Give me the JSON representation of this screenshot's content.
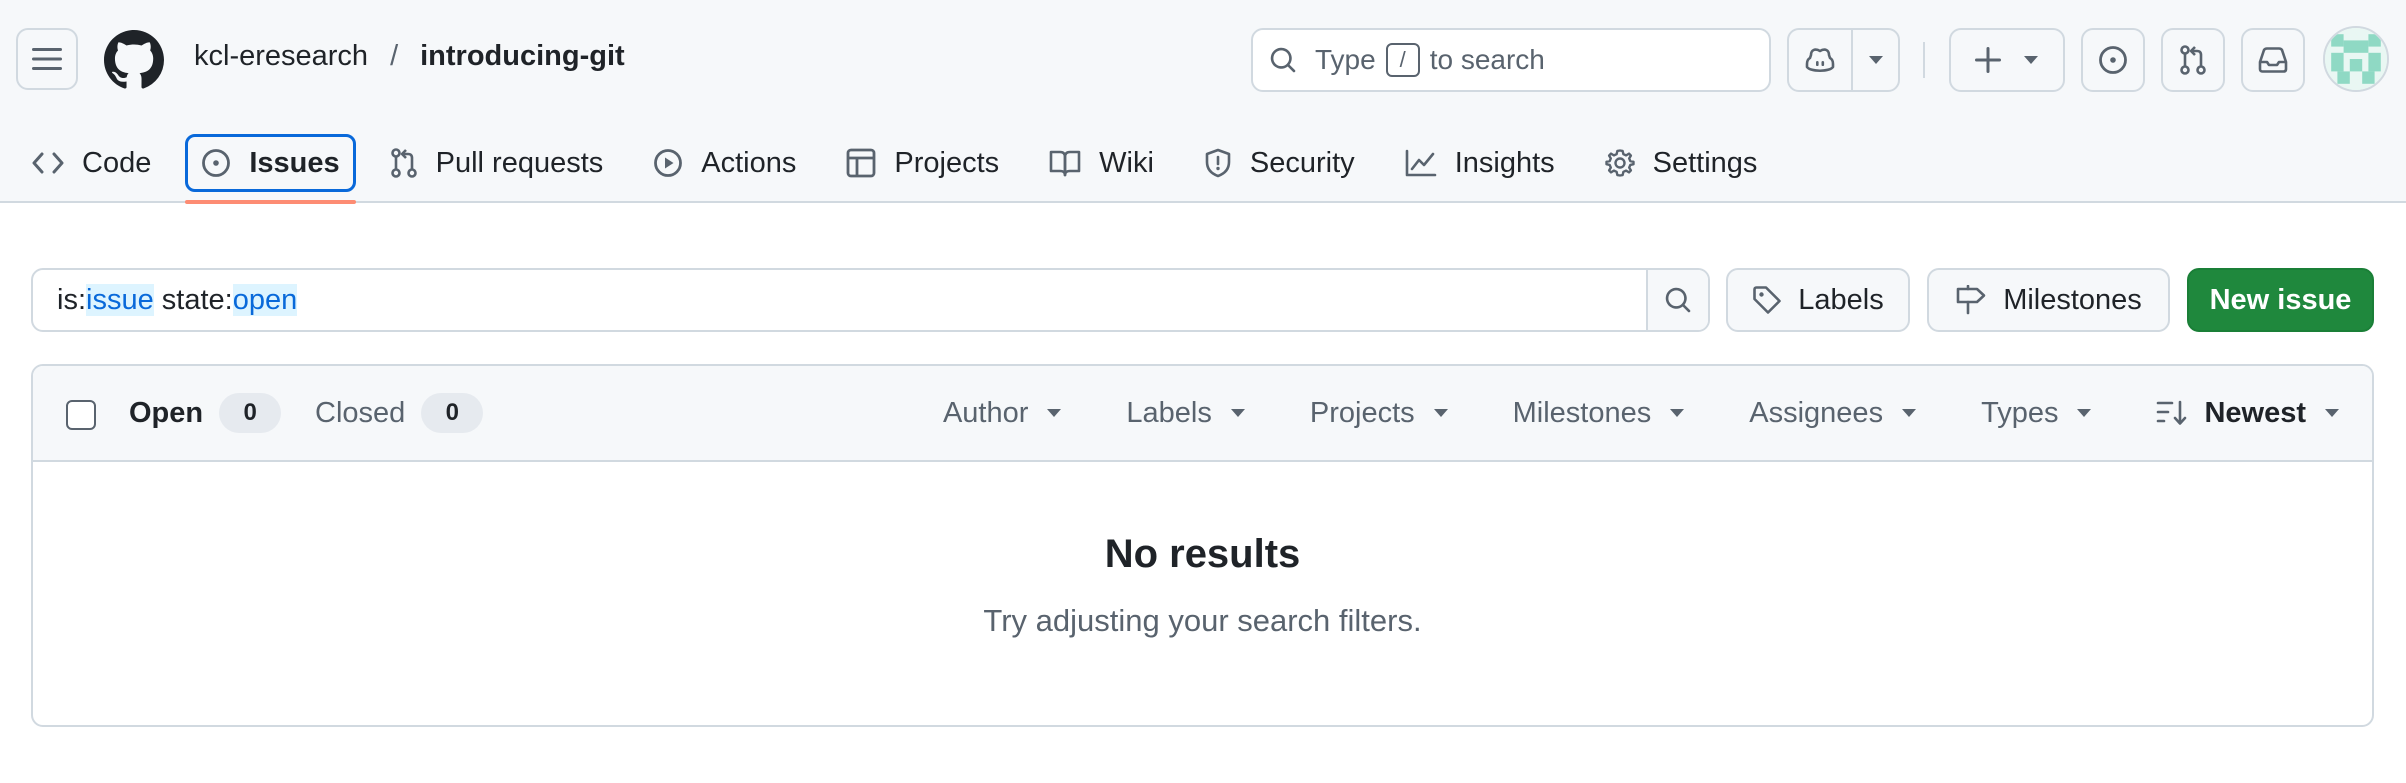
{
  "header": {
    "owner": "kcl-eresearch",
    "separator": "/",
    "repo": "introducing-git",
    "search": {
      "prefix": "Type",
      "key": "/",
      "suffix": "to search"
    }
  },
  "repo_nav": {
    "items": [
      {
        "label": "Code",
        "icon": "code-icon"
      },
      {
        "label": "Issues",
        "icon": "issue-opened-icon",
        "selected": true
      },
      {
        "label": "Pull requests",
        "icon": "git-pull-request-icon"
      },
      {
        "label": "Actions",
        "icon": "play-icon"
      },
      {
        "label": "Projects",
        "icon": "table-icon"
      },
      {
        "label": "Wiki",
        "icon": "book-icon"
      },
      {
        "label": "Security",
        "icon": "shield-icon"
      },
      {
        "label": "Insights",
        "icon": "graph-icon"
      },
      {
        "label": "Settings",
        "icon": "gear-icon"
      }
    ]
  },
  "filter_bar": {
    "query_parts": [
      {
        "text": "is:",
        "highlight": false
      },
      {
        "text": "issue",
        "highlight": true
      },
      {
        "text": " state:",
        "highlight": false
      },
      {
        "text": "open",
        "highlight": true
      }
    ],
    "labels_button": "Labels",
    "milestones_button": "Milestones",
    "new_issue_button": "New issue"
  },
  "issues_list": {
    "open_label": "Open",
    "open_count": "0",
    "closed_label": "Closed",
    "closed_count": "0",
    "filters": [
      "Author",
      "Labels",
      "Projects",
      "Milestones",
      "Assignees",
      "Types"
    ],
    "sort_label": "Newest",
    "empty_title": "No results",
    "empty_message": "Try adjusting your search filters."
  },
  "colors": {
    "accent": "#0969da",
    "primary_button": "#1f883d",
    "selected_underline": "#fd8c73",
    "border": "#d1d9e0"
  }
}
